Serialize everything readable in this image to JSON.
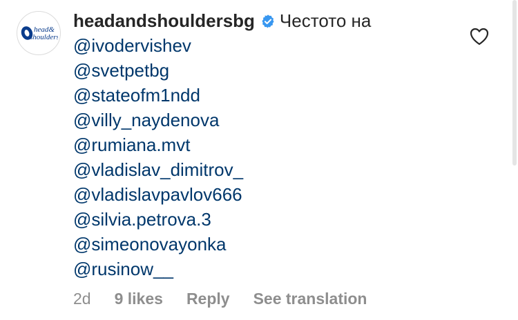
{
  "comment": {
    "username": "headandshoulders­bg",
    "verified": true,
    "text": "Честото на",
    "mentions": [
      "@ivodervishev",
      "@svetpetbg",
      "@stateofm1ndd",
      "@villy_naydenova",
      "@rumiana.mvt",
      "@vladislav_dimitrov_",
      "@vladislavpavlov666",
      "@silvia.petrova.3",
      "@simeonovayonka",
      "@rusinow__"
    ],
    "meta": {
      "time": "2d",
      "likes": "9 likes",
      "reply": "Reply",
      "translate": "See translation"
    }
  },
  "avatar": {
    "logo_line1": "head&",
    "logo_line2": "shoulders"
  },
  "colors": {
    "text": "#262626",
    "mention": "#00376b",
    "meta": "#8e8e8e",
    "verified": "#3897f0",
    "brand": "#0a3c8c"
  },
  "icons": {
    "verified": "verified-badge-icon",
    "like": "heart-outline-icon"
  }
}
